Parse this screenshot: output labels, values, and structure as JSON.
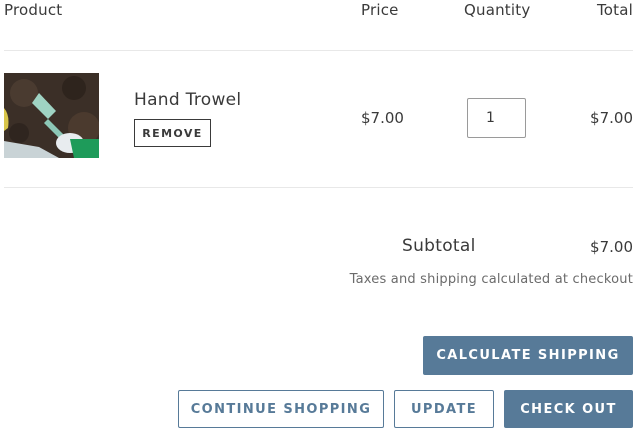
{
  "table": {
    "headers": {
      "product": "Product",
      "price": "Price",
      "quantity": "Quantity",
      "total": "Total"
    }
  },
  "cart": {
    "items": [
      {
        "name": "Hand Trowel",
        "remove_label": "REMOVE",
        "price": "$7.00",
        "quantity": "1",
        "total": "$7.00",
        "image_icon": "hand-trowel-product-image"
      }
    ]
  },
  "summary": {
    "subtotal_label": "Subtotal",
    "subtotal_value": "$7.00",
    "taxes_note": "Taxes and shipping calculated at checkout"
  },
  "actions": {
    "calculate_shipping": "CALCULATE SHIPPING",
    "continue_shopping": "CONTINUE SHOPPING",
    "update": "UPDATE",
    "checkout": "CHECK OUT"
  },
  "colors": {
    "accent": "#577a98",
    "text": "#3a3a3a",
    "muted": "#6b6b6b",
    "divider": "#e8e8e8"
  }
}
